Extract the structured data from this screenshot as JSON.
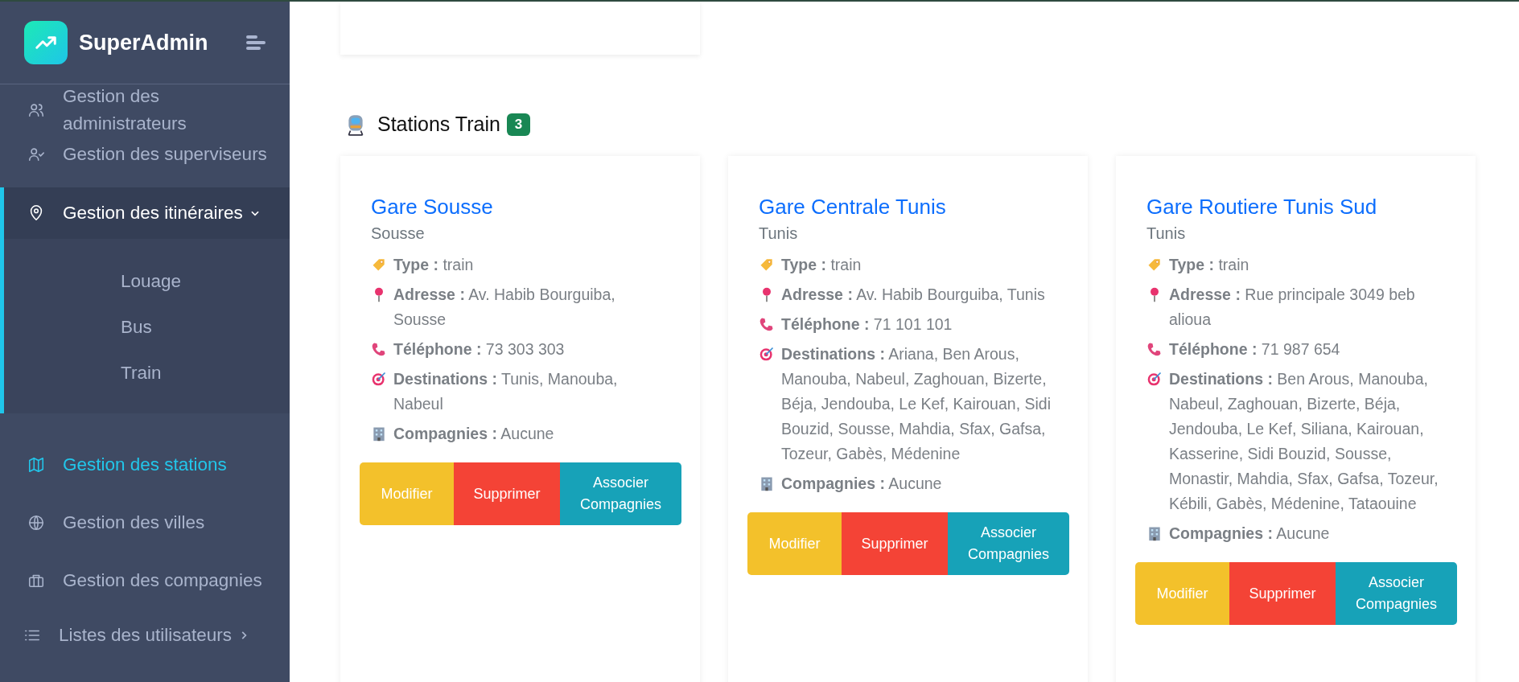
{
  "sidebar": {
    "brand": "SuperAdmin",
    "items": [
      {
        "kind": "link",
        "label": "Gestion des administrateurs",
        "selected": false
      },
      {
        "kind": "link",
        "label": "Gestion des superviseurs",
        "selected": false
      },
      {
        "kind": "group",
        "label": "Gestion des itinéraires",
        "selected": false,
        "expanded": true,
        "children": [
          {
            "label": "Louage",
            "selected": false
          },
          {
            "label": "Bus",
            "selected": false
          },
          {
            "label": "Train",
            "selected": false
          }
        ]
      },
      {
        "kind": "link",
        "label": "Gestion des stations",
        "selected": true
      },
      {
        "kind": "link",
        "label": "Gestion des villes",
        "selected": false
      },
      {
        "kind": "link",
        "label": "Gestion des compagnies",
        "selected": false
      },
      {
        "kind": "group",
        "label": "Listes des utilisateurs",
        "selected": false,
        "expanded": false
      }
    ]
  },
  "top_card": {
    "kind": "blank"
  },
  "section": {
    "title": "Stations Train",
    "count": "3",
    "stations": [
      {
        "name": "Gare Sousse",
        "city": "Sousse",
        "fields": [
          {
            "kind": "type",
            "text": "**Type :** train"
          },
          {
            "kind": "address",
            "text": "**Adresse :** Av. Habib Bourguiba, Sousse"
          },
          {
            "kind": "phone",
            "text": "**Téléphone :** 73 303 303"
          },
          {
            "kind": "destinations",
            "text": "**Destinations :** Tunis, Manouba, Nabeul"
          },
          {
            "kind": "companies",
            "text": "**Compagnies :** Aucune"
          }
        ],
        "buttons": [
          {
            "kind": "edit",
            "label": "Modifier"
          },
          {
            "kind": "delete",
            "label": "Supprimer"
          },
          {
            "kind": "link",
            "label": "Associer Compagnies"
          }
        ]
      },
      {
        "name": "Gare Centrale Tunis",
        "city": "Tunis",
        "fields": [
          {
            "kind": "type",
            "text": "**Type :** train"
          },
          {
            "kind": "address",
            "text": "**Adresse :** Av. Habib Bourguiba, Tunis"
          },
          {
            "kind": "phone",
            "text": "**Téléphone :** 71 101 101"
          },
          {
            "kind": "destinations",
            "text": "**Destinations :** Ariana, Ben Arous, Manouba, Nabeul, Zaghouan, Bizerte, Béja, Jendouba, Le Kef, Kairouan, Sidi Bouzid, Sousse, Mahdia, Sfax, Gafsa, Tozeur, Gabès, Médenine"
          },
          {
            "kind": "companies",
            "text": "**Compagnies :** Aucune"
          }
        ],
        "buttons": [
          {
            "kind": "edit",
            "label": "Modifier"
          },
          {
            "kind": "delete",
            "label": "Supprimer"
          },
          {
            "kind": "link",
            "label": "Associer Compagnies"
          }
        ]
      },
      {
        "name": "Gare Routiere Tunis Sud",
        "city": "Tunis",
        "fields": [
          {
            "kind": "type",
            "text": "**Type :** train"
          },
          {
            "kind": "address",
            "text": "**Adresse :** Rue principale 3049 beb alioua"
          },
          {
            "kind": "phone",
            "text": "**Téléphone :** 71 987 654"
          },
          {
            "kind": "destinations",
            "text": "**Destinations :** Ben Arous, Manouba, Nabeul, Zaghouan, Bizerte, Béja, Jendouba, Le Kef, Siliana, Kairouan, Kasserine, Sidi Bouzid, Sousse, Monastir, Mahdia, Sfax, Gafsa, Tozeur, Kébili, Gabès, Médenine, Tataouine"
          },
          {
            "kind": "companies",
            "text": "**Compagnies :** Aucune"
          }
        ],
        "buttons": [
          {
            "kind": "edit",
            "label": "Modifier"
          },
          {
            "kind": "delete",
            "label": "Supprimer"
          },
          {
            "kind": "link",
            "label": "Associer Compagnies"
          }
        ]
      }
    ]
  }
}
